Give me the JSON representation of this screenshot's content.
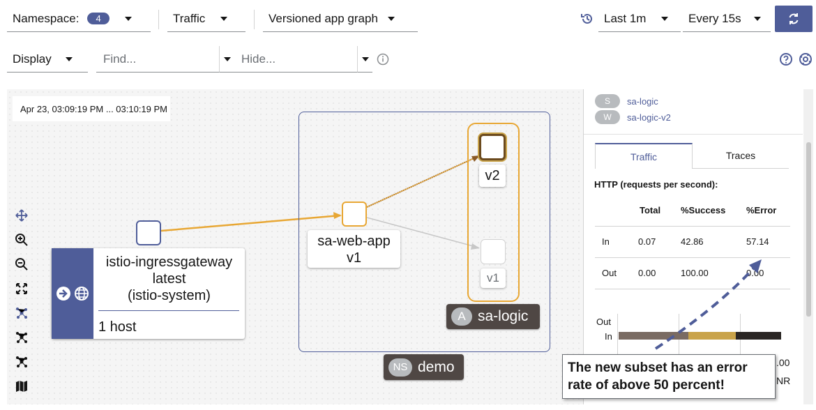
{
  "toolbar": {
    "namespace_label": "Namespace:",
    "namespace_count": "4",
    "traffic_label": "Traffic",
    "graph_type": "Versioned app graph",
    "duration": "Last 1m",
    "refresh_interval": "Every 15s",
    "display_label": "Display",
    "find_placeholder": "Find...",
    "hide_placeholder": "Hide..."
  },
  "graph": {
    "time_range": "Apr 23, 03:09:19 PM ... 03:10:19 PM",
    "gateway": {
      "name": "istio-ingressgateway",
      "version": "latest",
      "namespace": "(istio-system)",
      "hosts": "1 host"
    },
    "web_app": {
      "name": "sa-web-app",
      "version": "v1"
    },
    "logic_v2": "v2",
    "logic_v1": "v1",
    "app_group": {
      "badge": "A",
      "name": "sa-logic"
    },
    "namespace_box": {
      "badge": "NS",
      "name": "demo"
    }
  },
  "panel": {
    "service": {
      "badge": "S",
      "name": "sa-logic"
    },
    "workload": {
      "badge": "W",
      "name": "sa-logic-v2"
    },
    "tabs": [
      "Traffic",
      "Traces"
    ],
    "http_title": "HTTP (requests per second):",
    "table": {
      "headers": [
        "",
        "Total",
        "%Success",
        "%Error"
      ],
      "rows": [
        [
          "In",
          "0.07",
          "42.86",
          "57.14"
        ],
        [
          "Out",
          "0.00",
          "100.00",
          "0.00"
        ]
      ]
    },
    "bar_chart": {
      "labels": [
        "Out",
        "In"
      ],
      "in_segments": [
        {
          "fraction": 0.43,
          "color": "#7a6b63"
        },
        {
          "fraction": 0.29,
          "color": "#c9a34a"
        },
        {
          "fraction": 0.28,
          "color": "#2a2624"
        }
      ],
      "axis_partial": [
        ".00",
        "NR"
      ]
    }
  },
  "annotation": {
    "text": "The new subset has an error rate of above 50 percent!"
  },
  "colors": {
    "accent": "#4f5d99",
    "edge_active": "#f0ab00",
    "edge_inactive": "#c7c7c7",
    "arrow": "#4f5d99"
  }
}
